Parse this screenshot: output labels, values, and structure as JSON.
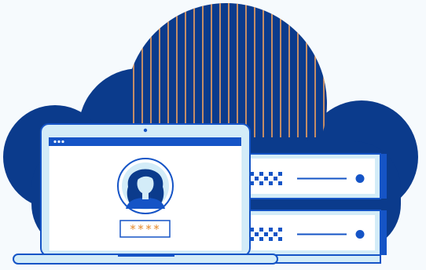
{
  "login": {
    "password_mask": "****"
  },
  "colors": {
    "cloud": "#0b3b8c",
    "stripe": "#f2a25c",
    "outline": "#1554c6",
    "light_fill": "#d3ecf8",
    "panel": "#ffffff",
    "screen_border": "#c5e6f6",
    "background": "#f6fafd",
    "mask_text": "#e58a2c"
  },
  "icons": {
    "avatar": "user-avatar-icon",
    "window_dots": "window-dots-icon",
    "server_grid": "server-grid-icon",
    "server_led": "server-led-icon"
  }
}
